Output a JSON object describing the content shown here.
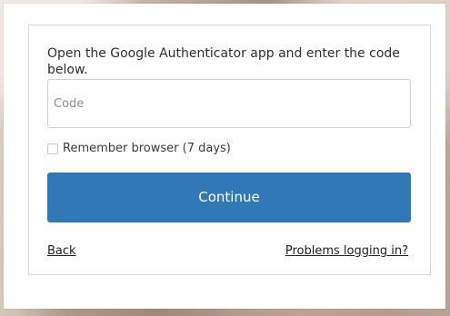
{
  "form": {
    "instructions": "Open the Google Authenticator app and enter the code below.",
    "code_input": {
      "placeholder": "Code",
      "value": ""
    },
    "remember_browser": {
      "label": "Remember browser (7 days)",
      "checked": false
    },
    "continue_label": "Continue",
    "back_label": "Back",
    "problems_label": "Problems logging in?"
  },
  "colors": {
    "accent": "#3178b6",
    "card_border": "#d8d8d8",
    "text": "#2d2d2d"
  }
}
